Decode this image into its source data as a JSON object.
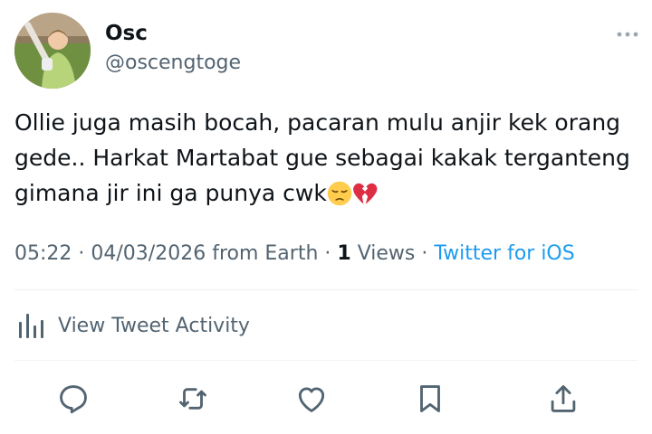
{
  "user": {
    "display_name": "Osc",
    "handle": "@oscengtoge"
  },
  "tweet": {
    "text": "Ollie juga masih bocah, pacaran mulu anjir kek orang gede.. Harkat Martabat gue sebagai kakak terganteng gimana jir ini ga punya cwk",
    "emojis": [
      "pensive-face-emoji",
      "broken-heart-emoji"
    ]
  },
  "meta": {
    "time": "05:22",
    "separator": " · ",
    "date": "04/03/2026",
    "location": "from Earth",
    "views_count": "1",
    "views_label": "Views",
    "source": "Twitter for iOS"
  },
  "activity": {
    "label": "View Tweet Activity"
  },
  "actions": [
    "reply-icon",
    "retweet-icon",
    "like-icon",
    "bookmark-icon",
    "share-icon"
  ],
  "colors": {
    "text": "#0f1419",
    "secondary": "#536471",
    "accent": "#1d9bf0",
    "divider": "#eff3f4"
  }
}
